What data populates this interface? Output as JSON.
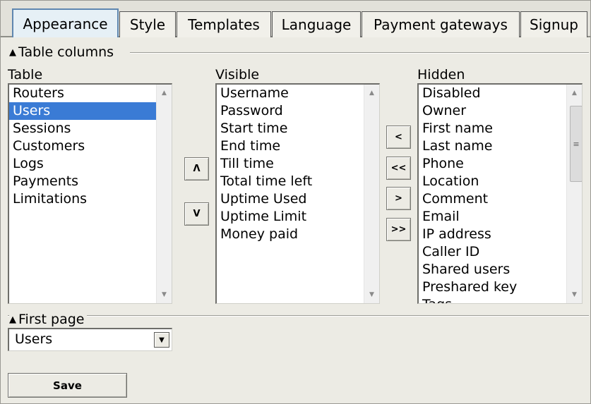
{
  "tabs": [
    {
      "label": "Appearance",
      "active": true
    },
    {
      "label": "Style",
      "active": false
    },
    {
      "label": "Templates",
      "active": false
    },
    {
      "label": "Language",
      "active": false
    },
    {
      "label": "Payment gateways",
      "active": false
    },
    {
      "label": "Signup",
      "active": false
    }
  ],
  "table_columns": {
    "header": "Table columns",
    "table_label": "Table",
    "visible_label": "Visible",
    "hidden_label": "Hidden",
    "table_items": [
      "Routers",
      "Users",
      "Sessions",
      "Customers",
      "Logs",
      "Payments",
      "Limitations"
    ],
    "table_selected": "Users",
    "visible_items": [
      "Username",
      "Password",
      "Start time",
      "End time",
      "Till time",
      "Total time left",
      "Uptime Used",
      "Uptime Limit",
      "Money paid"
    ],
    "hidden_items": [
      "Disabled",
      "Owner",
      "First name",
      "Last name",
      "Phone",
      "Location",
      "Comment",
      "Email",
      "IP address",
      "Caller ID",
      "Shared users",
      "Preshared key",
      "Tags"
    ],
    "order_buttons": {
      "up": "Λ",
      "down": "V"
    },
    "move_buttons": {
      "left": "<",
      "all_left": "<<",
      "right": ">",
      "all_right": ">>"
    }
  },
  "first_page": {
    "header": "First page",
    "selected": "Users"
  },
  "save_label": "Save",
  "icons": {
    "collapse": "▲",
    "scroll_up": "▲",
    "scroll_down": "▼",
    "dropdown": "▼",
    "thumb_grip": "≡"
  },
  "colors": {
    "selection": "#3a7bd5",
    "active_tab": "#e6f0f6",
    "background": "#ecebe4"
  }
}
